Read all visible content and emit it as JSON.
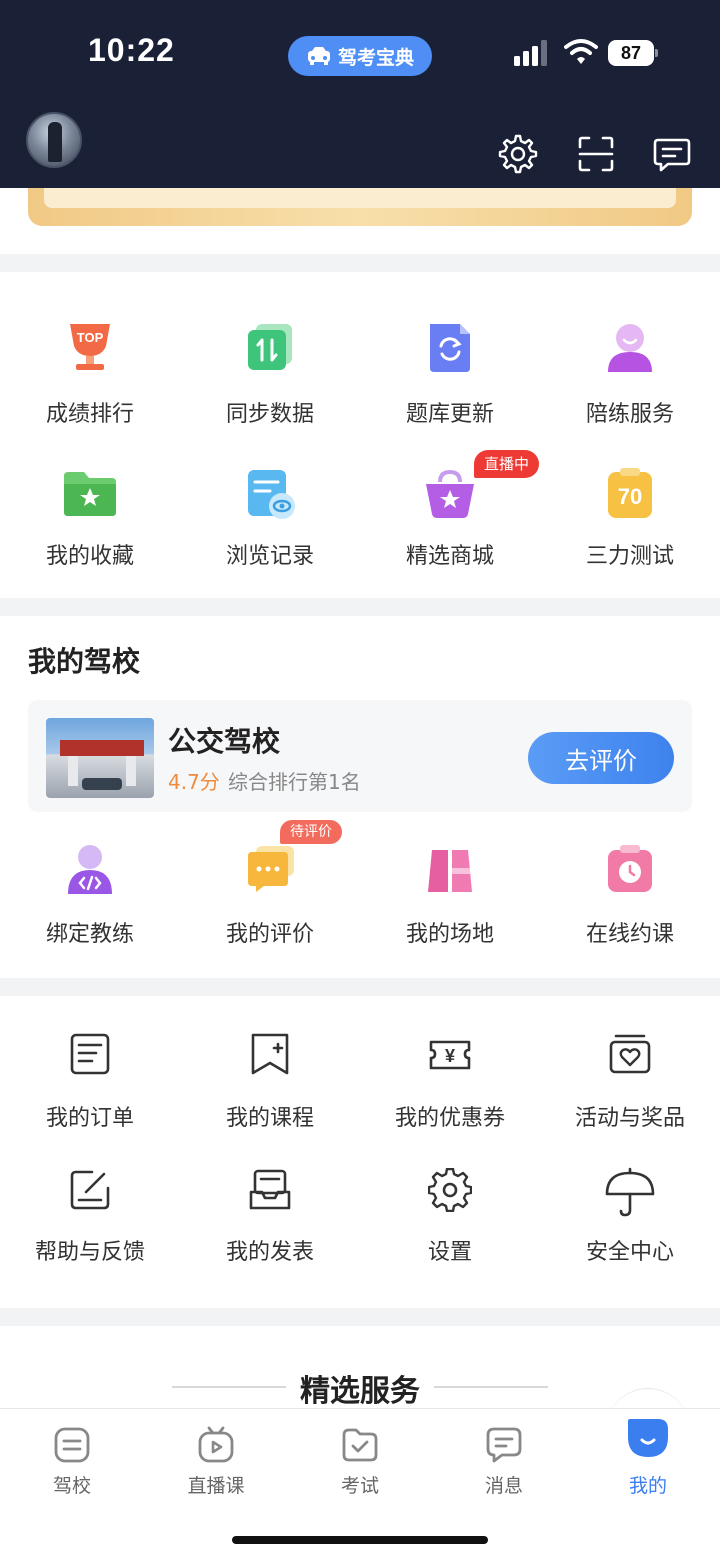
{
  "status_bar": {
    "time": "10:22",
    "app_pill": "驾考宝典",
    "battery": "87"
  },
  "header": {
    "icons": [
      "settings-icon",
      "scan-icon",
      "message-icon"
    ]
  },
  "tools": {
    "items": [
      {
        "label": "成绩排行",
        "icon": "top-trophy-icon",
        "icon_text": "TOP"
      },
      {
        "label": "同步数据",
        "icon": "sync-data-icon"
      },
      {
        "label": "题库更新",
        "icon": "refresh-doc-icon"
      },
      {
        "label": "陪练服务",
        "icon": "coach-person-icon"
      },
      {
        "label": "我的收藏",
        "icon": "favorite-folder-icon"
      },
      {
        "label": "浏览记录",
        "icon": "history-doc-icon"
      },
      {
        "label": "精选商城",
        "icon": "shop-basket-icon",
        "badge": "直播中"
      },
      {
        "label": "三力测试",
        "icon": "three-ability-test-icon",
        "icon_text": "70"
      }
    ]
  },
  "my_school": {
    "title": "我的驾校",
    "name": "公交驾校",
    "rating": "4.7分",
    "rank": "综合排行第1名",
    "rate_button": "去评价",
    "actions": [
      {
        "label": "绑定教练",
        "icon": "bind-coach-icon"
      },
      {
        "label": "我的评价",
        "icon": "my-review-icon",
        "badge": "待评价"
      },
      {
        "label": "我的场地",
        "icon": "my-venue-icon"
      },
      {
        "label": "在线约课",
        "icon": "online-booking-icon"
      }
    ]
  },
  "services": {
    "items": [
      {
        "label": "我的订单",
        "icon": "order-icon"
      },
      {
        "label": "我的课程",
        "icon": "course-icon"
      },
      {
        "label": "我的优惠券",
        "icon": "coupon-icon",
        "coupon_symbol": "¥"
      },
      {
        "label": "活动与奖品",
        "icon": "prize-icon"
      },
      {
        "label": "帮助与反馈",
        "icon": "feedback-icon"
      },
      {
        "label": "我的发表",
        "icon": "post-icon"
      },
      {
        "label": "设置",
        "icon": "settings-icon"
      },
      {
        "label": "安全中心",
        "icon": "umbrella-icon"
      }
    ]
  },
  "featured": {
    "title": "精选服务"
  },
  "tabbar": {
    "tabs": [
      {
        "label": "驾校",
        "icon": "school-tab-icon"
      },
      {
        "label": "直播课",
        "icon": "live-tab-icon"
      },
      {
        "label": "考试",
        "icon": "exam-tab-icon"
      },
      {
        "label": "消息",
        "icon": "message-tab-icon"
      },
      {
        "label": "我的",
        "icon": "me-tab-icon",
        "active": true
      }
    ]
  },
  "colors": {
    "header_bg": "#1a2036",
    "accent_blue": "#3a7ef0",
    "badge_red": "#ee3a34",
    "rating_orange": "#f08b3c"
  }
}
